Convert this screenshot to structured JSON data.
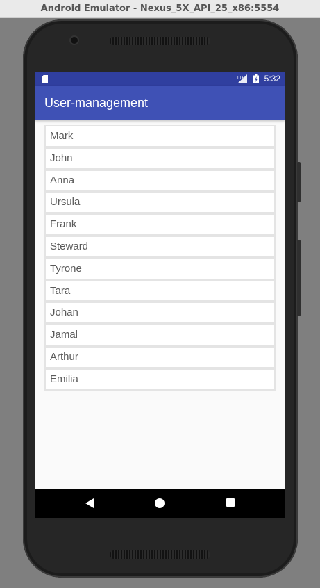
{
  "window": {
    "title": "Android Emulator - Nexus_5X_API_25_x86:5554"
  },
  "status_bar": {
    "time": "5:32",
    "network_badge": "LTE",
    "icons": [
      "sd-card-icon",
      "signal-icon",
      "battery-charging-icon"
    ]
  },
  "app_bar": {
    "title": "User-management"
  },
  "users": [
    "Mark",
    "John",
    "Anna",
    "Ursula",
    "Frank",
    "Steward",
    "Tyrone",
    "Tara",
    "Johan",
    "Jamal",
    "Arthur",
    "Emilia"
  ],
  "nav_bar": {
    "icons": [
      "back-icon",
      "home-icon",
      "recents-icon"
    ]
  },
  "colors": {
    "primary": "#3f51b5",
    "primary_dark": "#303f9f",
    "list_border": "#e4e4e4",
    "list_text": "#5a5a5a",
    "background": "#fafafa"
  }
}
